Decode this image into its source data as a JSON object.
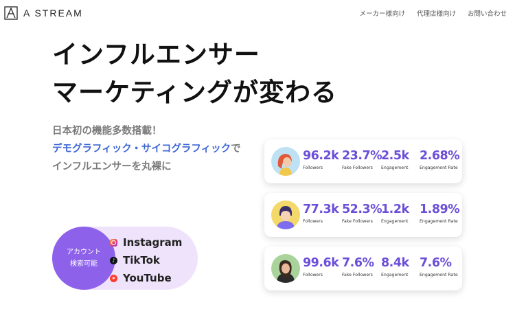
{
  "header": {
    "brand": "A STREAM",
    "nav": [
      "メーカー様向け",
      "代理店様向け",
      "お問い合わせ"
    ]
  },
  "hero": {
    "title_line1": "インフルエンサー",
    "title_line2": "マーケティングが変わる",
    "sub_line1": "日本初の機能多数搭載！",
    "sub_line2_accent": "デモグラフィック・サイコグラフィック",
    "sub_line2_rest": "で",
    "sub_line3": "インフルエンサーを丸裸に"
  },
  "search_badge": {
    "circle_line1": "アカウント",
    "circle_line2": "検索可能",
    "platforms": [
      {
        "name": "Instagram",
        "icon": "instagram-icon"
      },
      {
        "name": "TikTok",
        "icon": "tiktok-icon"
      },
      {
        "name": "YouTube",
        "icon": "youtube-icon"
      }
    ]
  },
  "stat_labels": [
    "Followers",
    "Fake Followers",
    "Engagement",
    "Engagement Rate"
  ],
  "influencers": [
    {
      "followers": "96.2k",
      "fake_followers": "23.7%",
      "engagement": "2.5k",
      "engagement_rate": "2.68%"
    },
    {
      "followers": "77.3k",
      "fake_followers": "52.3%",
      "engagement": "1.2k",
      "engagement_rate": "1.89%"
    },
    {
      "followers": "99.6k",
      "fake_followers": "7.6%",
      "engagement": "8.4k",
      "engagement_rate": "7.6%"
    }
  ],
  "colors": {
    "accent_purple": "#6b4fd8",
    "badge_purple": "#8d61ea",
    "badge_bg": "#efe3fc",
    "link_blue": "#3e66d6"
  }
}
